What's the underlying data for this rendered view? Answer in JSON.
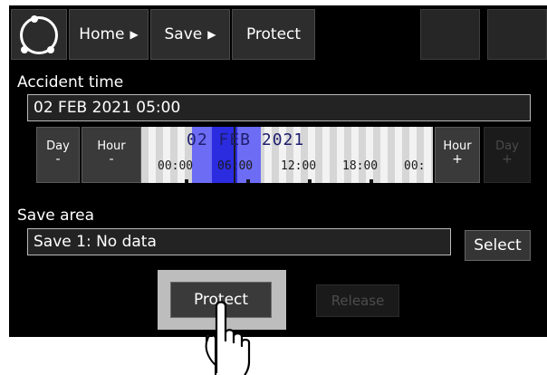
{
  "nav": {
    "crumbs": [
      {
        "label": "Home",
        "arrow": "▶"
      },
      {
        "label": "Save",
        "arrow": "▶"
      },
      {
        "label": "Protect",
        "arrow": ""
      }
    ]
  },
  "accident": {
    "label": "Accident time",
    "value": "02 FEB 2021 05:00"
  },
  "steppers": {
    "day_minus": {
      "line1": "Day",
      "line2": "-"
    },
    "hour_minus": {
      "line1": "Hour",
      "line2": "-"
    },
    "hour_plus": {
      "line1": "Hour",
      "line2": "+"
    },
    "day_plus": {
      "line1": "Day",
      "line2": "+"
    }
  },
  "timeline": {
    "date": "02 FEB 2021",
    "ticks": [
      "00:00",
      "06:00",
      "12:00",
      "18:00",
      "00:"
    ],
    "colors": {
      "highlight": "#6c6cf4",
      "selected": "#2b2be0"
    }
  },
  "save_area": {
    "label": "Save area",
    "value": "Save 1: No data",
    "select_label": "Select"
  },
  "actions": {
    "protect_label": "Protect",
    "release_label": "Release"
  },
  "icons": {
    "logo": "circle-logo-icon",
    "pointer": "pointing-hand-icon"
  }
}
